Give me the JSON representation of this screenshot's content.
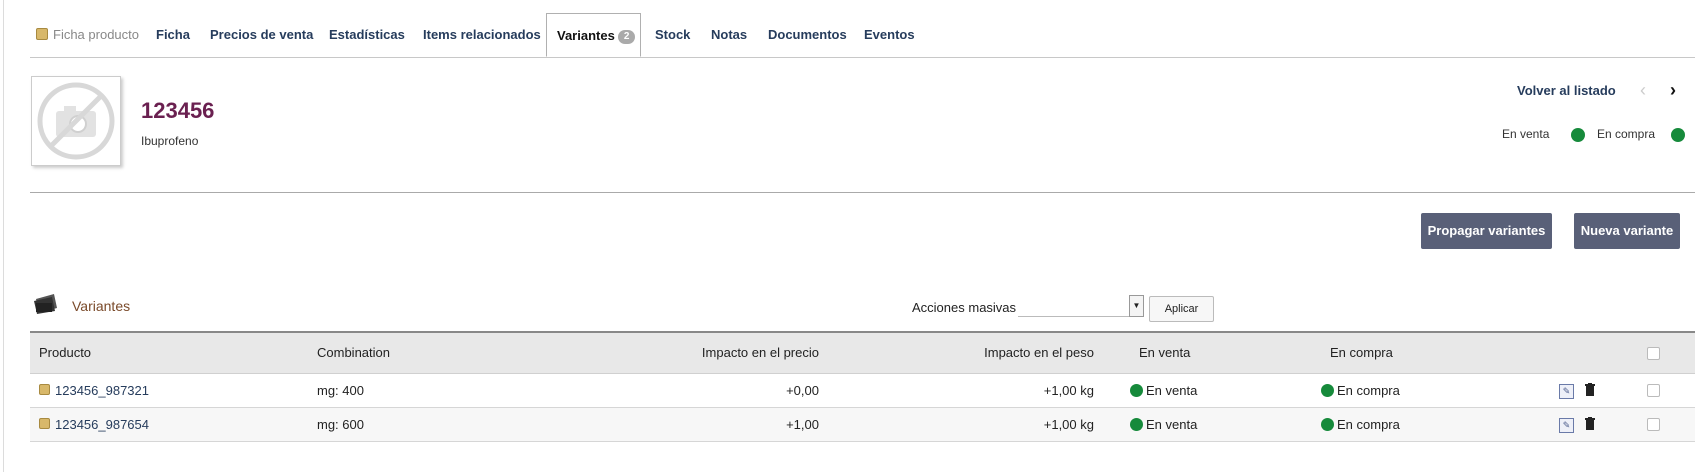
{
  "tabs": [
    {
      "label": "Ficha producto"
    },
    {
      "label": "Ficha"
    },
    {
      "label": "Precios de venta"
    },
    {
      "label": "Estadísticas"
    },
    {
      "label": "Items relacionados"
    },
    {
      "label": "Variantes",
      "badge": "2"
    },
    {
      "label": "Stock"
    },
    {
      "label": "Notas"
    },
    {
      "label": "Documentos"
    },
    {
      "label": "Eventos"
    }
  ],
  "product": {
    "ref": "123456",
    "label": "Ibuprofeno",
    "back_link": "Volver al listado",
    "status_sell": "En venta",
    "status_buy": "En compra"
  },
  "actions": {
    "propagate": "Propagar variantes",
    "new_variant": "Nueva variante"
  },
  "section": {
    "title": "Variantes",
    "mass_actions_label": "Acciones masivas",
    "mass_actions_value": "",
    "apply": "Aplicar"
  },
  "table": {
    "headers": {
      "product": "Producto",
      "combination": "Combination",
      "price_impact": "Impacto en el precio",
      "weight_impact": "Impacto en el peso",
      "on_sale": "En venta",
      "on_buy": "En compra"
    },
    "rows": [
      {
        "product": "123456_987321",
        "combination": "mg: 400",
        "price_impact": "+0,00",
        "weight_impact": "+1,00 kg",
        "on_sale": "En venta",
        "on_buy": "En compra"
      },
      {
        "product": "123456_987654",
        "combination": "mg: 600",
        "price_impact": "+1,00",
        "weight_impact": "+1,00 kg",
        "on_sale": "En venta",
        "on_buy": "En compra"
      }
    ]
  },
  "colors": {
    "status_green": "#168a3b",
    "button_bg": "#596078",
    "ref_color": "#6a2050",
    "link_color": "#263c5c"
  },
  "icons": {
    "product": "product-box-icon",
    "photo": "no-photo-icon",
    "title": "variants-folder-icon",
    "edit": "edit-icon",
    "delete": "trash-icon",
    "prev": "chevron-left-icon",
    "next": "chevron-right-icon"
  }
}
